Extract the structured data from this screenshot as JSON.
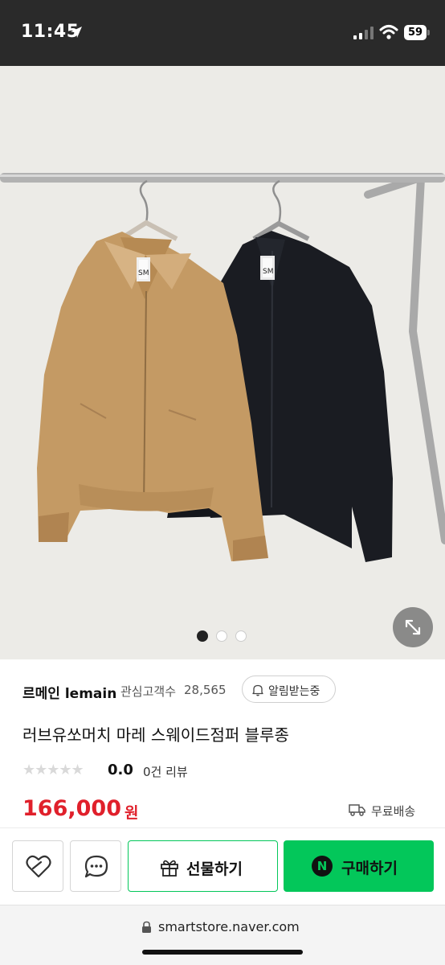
{
  "status_bar": {
    "time": "11:45",
    "battery": "59"
  },
  "carousel": {
    "total": 3,
    "active": 0
  },
  "store": {
    "name": "르메인 lemain",
    "followers_label": "관심고객수",
    "followers_count": "28,565",
    "alarm_label": "알림받는중"
  },
  "product": {
    "title": "러브유쏘머치 마레 스웨이드점퍼 블루종",
    "stars": "★★★★★",
    "rating": "0.0",
    "review_count": "0건 리뷰",
    "price": "166,000",
    "currency": "원",
    "shipping": "무료배송"
  },
  "actions": {
    "gift_label": "선물하기",
    "buy_icon": "N",
    "buy_label": "구매하기"
  },
  "browser": {
    "url": "smartstore.naver.com"
  },
  "colors": {
    "price": "#e0202b",
    "naver_green": "#03c75a"
  },
  "icons": [
    "location-arrow-icon",
    "signal-icon",
    "wifi-icon",
    "expand-icon",
    "bell-icon",
    "truck-icon",
    "heart-icon",
    "chat-icon",
    "gift-icon",
    "lock-icon"
  ]
}
